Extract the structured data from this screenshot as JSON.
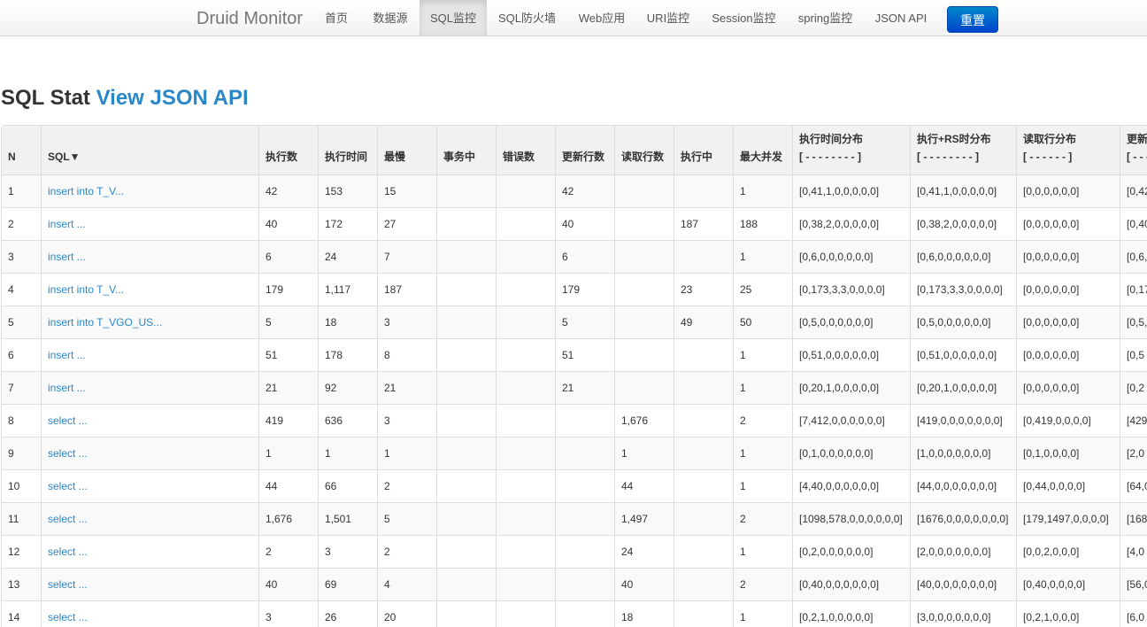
{
  "nav": {
    "brand": "Druid Monitor",
    "items": [
      "首页",
      "数据源",
      "SQL监控",
      "SQL防火墙",
      "Web应用",
      "URI监控",
      "Session监控",
      "spring监控",
      "JSON API"
    ],
    "active_index": 2,
    "reset_label": "重置"
  },
  "title": {
    "text": "SQL Stat",
    "link": "View JSON API"
  },
  "table": {
    "headers": [
      {
        "label": "N",
        "sub": ""
      },
      {
        "label": "SQL▼",
        "sub": ""
      },
      {
        "label": "执行数",
        "sub": ""
      },
      {
        "label": "执行时间",
        "sub": ""
      },
      {
        "label": "最慢",
        "sub": ""
      },
      {
        "label": "事务中",
        "sub": ""
      },
      {
        "label": "错误数",
        "sub": ""
      },
      {
        "label": "更新行数",
        "sub": ""
      },
      {
        "label": "读取行数",
        "sub": ""
      },
      {
        "label": "执行中",
        "sub": ""
      },
      {
        "label": "最大并发",
        "sub": ""
      },
      {
        "label": "执行时间分布",
        "sub": "[ - - - - - - - - ]"
      },
      {
        "label": "执行+RS时分布",
        "sub": "[ - - - - - - - - ]"
      },
      {
        "label": "读取行分布",
        "sub": "[ - - - - - - ]"
      },
      {
        "label": "更新",
        "sub": "[ - - -"
      }
    ],
    "rows": [
      [
        "1",
        "insert into T_V...",
        "42",
        "153",
        "15",
        "",
        "",
        "42",
        "",
        "",
        "1",
        "[0,41,1,0,0,0,0,0]",
        "[0,41,1,0,0,0,0,0]",
        "[0,0,0,0,0,0]",
        "[0,42"
      ],
      [
        "2",
        "insert ...",
        "40",
        "172",
        "27",
        "",
        "",
        "40",
        "",
        "187",
        "188",
        "[0,38,2,0,0,0,0,0]",
        "[0,38,2,0,0,0,0,0]",
        "[0,0,0,0,0,0]",
        "[0,40"
      ],
      [
        "3",
        "insert ...",
        "6",
        "24",
        "7",
        "",
        "",
        "6",
        "",
        "",
        "1",
        "[0,6,0,0,0,0,0,0]",
        "[0,6,0,0,0,0,0,0]",
        "[0,0,0,0,0,0]",
        "[0,6,"
      ],
      [
        "4",
        "insert into T_V...",
        "179",
        "1,117",
        "187",
        "",
        "",
        "179",
        "",
        "23",
        "25",
        "[0,173,3,3,0,0,0,0]",
        "[0,173,3,3,0,0,0,0]",
        "[0,0,0,0,0,0]",
        "[0,17"
      ],
      [
        "5",
        "insert into T_VGO_US...",
        "5",
        "18",
        "3",
        "",
        "",
        "5",
        "",
        "49",
        "50",
        "[0,5,0,0,0,0,0,0]",
        "[0,5,0,0,0,0,0,0]",
        "[0,0,0,0,0,0]",
        "[0,5,"
      ],
      [
        "6",
        "insert ...",
        "51",
        "178",
        "8",
        "",
        "",
        "51",
        "",
        "",
        "1",
        "[0,51,0,0,0,0,0,0]",
        "[0,51,0,0,0,0,0,0]",
        "[0,0,0,0,0,0]",
        "[0,5"
      ],
      [
        "7",
        "insert ...",
        "21",
        "92",
        "21",
        "",
        "",
        "21",
        "",
        "",
        "1",
        "[0,20,1,0,0,0,0,0]",
        "[0,20,1,0,0,0,0,0]",
        "[0,0,0,0,0,0]",
        "[0,2"
      ],
      [
        "8",
        "select ...",
        "419",
        "636",
        "3",
        "",
        "",
        "",
        "1,676",
        "",
        "2",
        "[7,412,0,0,0,0,0,0]",
        "[419,0,0,0,0,0,0,0]",
        "[0,419,0,0,0,0]",
        "[429"
      ],
      [
        "9",
        "select ...",
        "1",
        "1",
        "1",
        "",
        "",
        "",
        "1",
        "",
        "1",
        "[0,1,0,0,0,0,0,0]",
        "[1,0,0,0,0,0,0,0]",
        "[0,1,0,0,0,0]",
        "[2,0"
      ],
      [
        "10",
        "select ...",
        "44",
        "66",
        "2",
        "",
        "",
        "",
        "44",
        "",
        "1",
        "[4,40,0,0,0,0,0,0]",
        "[44,0,0,0,0,0,0,0]",
        "[0,44,0,0,0,0]",
        "[64,0"
      ],
      [
        "11",
        "select ...",
        "1,676",
        "1,501",
        "5",
        "",
        "",
        "",
        "1,497",
        "",
        "2",
        "[1098,578,0,0,0,0,0,0]",
        "[1676,0,0,0,0,0,0,0]",
        "[179,1497,0,0,0,0]",
        "[168"
      ],
      [
        "12",
        "select ...",
        "2",
        "3",
        "2",
        "",
        "",
        "",
        "24",
        "",
        "1",
        "[0,2,0,0,0,0,0,0]",
        "[2,0,0,0,0,0,0,0]",
        "[0,0,2,0,0,0]",
        "[4,0"
      ],
      [
        "13",
        "select ...",
        "40",
        "69",
        "4",
        "",
        "",
        "",
        "40",
        "",
        "2",
        "[0,40,0,0,0,0,0,0]",
        "[40,0,0,0,0,0,0,0]",
        "[0,40,0,0,0,0]",
        "[56,0"
      ],
      [
        "14",
        "select ...",
        "3",
        "26",
        "20",
        "",
        "",
        "",
        "18",
        "",
        "1",
        "[0,2,1,0,0,0,0,0]",
        "[3,0,0,0,0,0,0,0]",
        "[0,2,1,0,0,0]",
        "[6,0"
      ]
    ]
  }
}
